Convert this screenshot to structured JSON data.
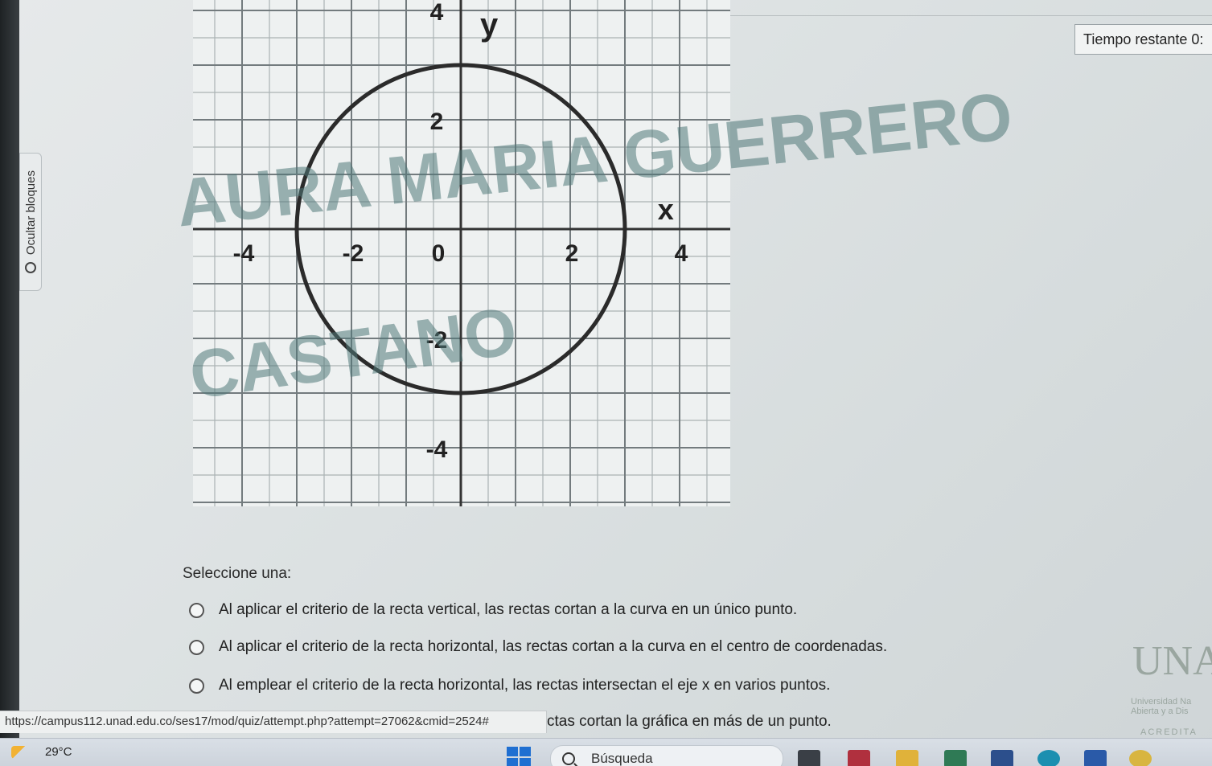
{
  "sidebar": {
    "toggle_label": "Ocultar bloques",
    "toggle_icon": "circle-icon"
  },
  "timer": {
    "label": "Tiempo restante 0:"
  },
  "graph": {
    "axis_x_label": "x",
    "axis_y_label": "y",
    "x_ticks": [
      "-4",
      "-2",
      "0",
      "2",
      "4"
    ],
    "y_ticks": [
      "4",
      "2",
      "-2",
      "-4"
    ],
    "circle": {
      "center": [
        0,
        0
      ],
      "radius": 3
    }
  },
  "watermark": {
    "line1": "AURA MARIA GUERRERO",
    "line2": "CASTANO"
  },
  "question": {
    "prompt": "Seleccione una:",
    "options": [
      "Al aplicar el criterio de la recta vertical, las rectas cortan a la curva en un único punto.",
      "Al aplicar el criterio de la recta horizontal, las rectas cortan a la curva en el centro de coordenadas.",
      "Al emplear el criterio de la recta horizontal, las rectas intersectan el eje x en varios puntos.",
      "ctas cortan la gráfica en más de un punto."
    ]
  },
  "status_url": "https://campus112.unad.edu.co/ses17/mod/quiz/attempt.php?attempt=27062&cmid=2524#",
  "logo": {
    "letters": "UNA",
    "line1": "Universidad Na",
    "line2": "Abierta y a Dis",
    "line3": "ACREDITA"
  },
  "taskbar": {
    "weather": "29°C",
    "search_placeholder": "Búsqueda",
    "icons": [
      "file-explorer-icon",
      "mail-icon",
      "folder-icon",
      "store-icon",
      "app-icon",
      "edge-icon",
      "word-icon",
      "chrome-icon"
    ]
  }
}
